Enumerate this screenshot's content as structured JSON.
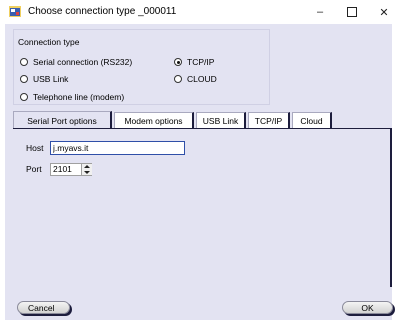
{
  "window": {
    "title": "Choose connection type  _000011",
    "minimize": "–",
    "close": "✕"
  },
  "connection_type": {
    "title": "Connection type",
    "options": [
      {
        "label": "Serial connection (RS232)",
        "checked": false
      },
      {
        "label": "USB Link",
        "checked": false
      },
      {
        "label": "Telephone line (modem)",
        "checked": false
      },
      {
        "label": "TCP/IP",
        "checked": true
      },
      {
        "label": "CLOUD",
        "checked": false
      }
    ]
  },
  "tabs": [
    {
      "label": "Serial Port options",
      "active": true
    },
    {
      "label": "Modem options",
      "active": false
    },
    {
      "label": "USB Link",
      "active": false
    },
    {
      "label": "TCP/IP",
      "active": false
    },
    {
      "label": "Cloud",
      "active": false
    }
  ],
  "fields": {
    "host_label": "Host",
    "host_value": "j.myavs.it",
    "port_label": "Port",
    "port_value": "2101"
  },
  "buttons": {
    "cancel": "Cancel",
    "ok": "OK"
  },
  "colors": {
    "client_bg": "#e3e3f2",
    "dark_border": "#1d1d3d",
    "focus_border": "#2f4fa8"
  },
  "icons": {
    "app": "app-window-icon",
    "minimize": "minimize-icon",
    "maximize": "maximize-icon",
    "close": "close-icon"
  }
}
